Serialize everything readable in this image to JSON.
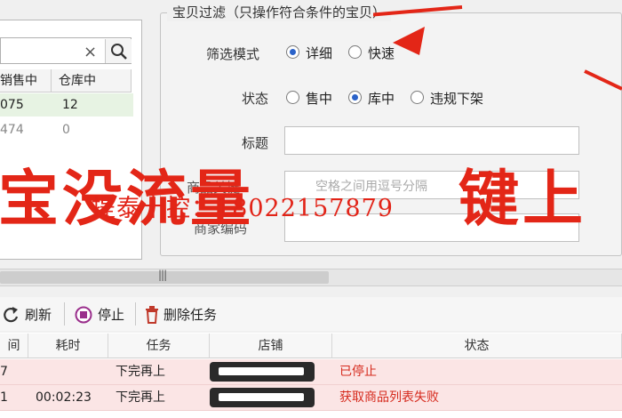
{
  "search": {
    "clear_glyph": "×",
    "icon": "search-icon"
  },
  "product_grid": {
    "columns": [
      "销售中",
      "仓库中"
    ],
    "rows": [
      {
        "sold": "075",
        "stock": "12"
      },
      {
        "sold": "474",
        "stock": "0"
      }
    ]
  },
  "filter": {
    "legend": "宝贝过滤（只操作符合条件的宝贝）",
    "mode_label": "筛选模式",
    "mode_options": [
      "详细",
      "快速"
    ],
    "mode_selected": "详细",
    "status_label": "状态",
    "status_options": [
      "售中",
      "库中",
      "违规下架"
    ],
    "status_selected": "库中",
    "title_label": "标题",
    "title_value": "",
    "keyword_label": "商品关键",
    "keyword_placeholder": "空格之间用逗号分隔",
    "category_label": "商家编码"
  },
  "overlay": {
    "left_text": "宝没流量",
    "right_text": "键上",
    "contact": "提泰十控：18022157879"
  },
  "scrollbar": {
    "grip": "|||"
  },
  "toolbar": {
    "refresh": "刷新",
    "stop": "停止",
    "delete_task": "删除任务"
  },
  "tasks": {
    "columns": [
      "间",
      "耗时",
      "任务",
      "店铺",
      "状态"
    ],
    "rows": [
      {
        "id": "7",
        "elapsed": "",
        "task": "下完再上",
        "shop": "",
        "status": "已停止"
      },
      {
        "id": "1",
        "elapsed": "00:02:23",
        "task": "下完再上",
        "shop": "",
        "status": "获取商品列表失败"
      }
    ]
  },
  "colors": {
    "accent": "#2a62c9",
    "overlay_red": "#e32617",
    "row_highlight": "#fbe5e5"
  }
}
